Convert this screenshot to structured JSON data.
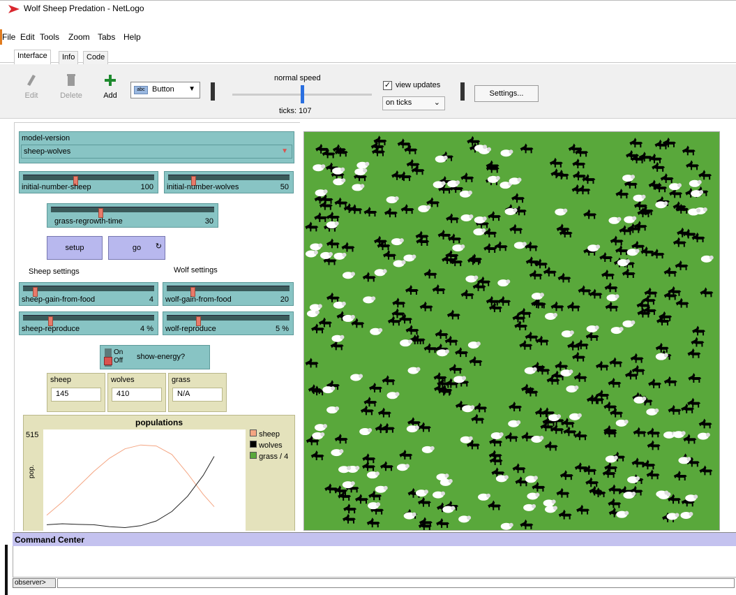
{
  "window": {
    "title": "Wolf Sheep Predation - NetLogo"
  },
  "menu": [
    "File",
    "Edit",
    "Tools",
    "Zoom",
    "Tabs",
    "Help"
  ],
  "tabs": [
    {
      "label": "Interface",
      "active": true
    },
    {
      "label": "Info",
      "active": false
    },
    {
      "label": "Code",
      "active": false
    }
  ],
  "toolbar": {
    "edit": "Edit",
    "delete": "Delete",
    "add": "Add",
    "widget_type": "Button",
    "speed_label": "normal speed",
    "speed_fraction": 0.5,
    "ticks": "ticks: 107",
    "view_updates_label": "view updates",
    "view_updates_checked": true,
    "update_mode": "on ticks",
    "settings": "Settings..."
  },
  "widgets": {
    "chooser": {
      "label": "model-version",
      "value": "sheep-wolves"
    },
    "sliders": {
      "initial_sheep": {
        "label": "initial-number-sheep",
        "value": "100",
        "fraction": 0.4
      },
      "initial_wolves": {
        "label": "initial-number-wolves",
        "value": "50",
        "fraction": 0.2
      },
      "grass_regrowth": {
        "label": "grass-regrowth-time",
        "value": "30",
        "fraction": 0.3
      },
      "sheep_gain": {
        "label": "sheep-gain-from-food",
        "value": "4",
        "fraction": 0.08
      },
      "wolf_gain": {
        "label": "wolf-gain-from-food",
        "value": "20",
        "fraction": 0.2
      },
      "sheep_reproduce": {
        "label": "sheep-reproduce",
        "value": "4 %",
        "fraction": 0.2
      },
      "wolf_reproduce": {
        "label": "wolf-reproduce",
        "value": "5 %",
        "fraction": 0.25
      }
    },
    "buttons": {
      "setup": "setup",
      "go": "go"
    },
    "notes": {
      "sheep_settings": "Sheep settings",
      "wolf_settings": "Wolf settings"
    },
    "switch": {
      "label": "show-energy?",
      "on": "On",
      "off": "Off",
      "state": "off"
    },
    "monitors": [
      {
        "label": "sheep",
        "value": "145"
      },
      {
        "label": "wolves",
        "value": "410"
      },
      {
        "label": "grass",
        "value": "N/A"
      }
    ]
  },
  "plot": {
    "title": "populations",
    "ylabel": "pop.",
    "ymax_label": "515",
    "legend": [
      {
        "name": "sheep",
        "color": "#f4a582"
      },
      {
        "name": "wolves",
        "color": "#000000"
      },
      {
        "name": "grass / 4",
        "color": "#59a83b"
      }
    ]
  },
  "chart_data": {
    "type": "line",
    "title": "populations",
    "ylabel": "pop.",
    "ylim": [
      0,
      515
    ],
    "x": [
      0,
      10,
      20,
      30,
      40,
      50,
      60,
      70,
      80,
      90,
      100,
      107
    ],
    "series": [
      {
        "name": "sheep",
        "values": [
          100,
          170,
          250,
          330,
          400,
          450,
          470,
          465,
          420,
          320,
          210,
          145
        ]
      },
      {
        "name": "wolves",
        "values": [
          50,
          55,
          52,
          50,
          40,
          35,
          45,
          70,
          120,
          200,
          310,
          410
        ]
      }
    ]
  },
  "command_center": {
    "title": "Command Center",
    "prompt": "observer>"
  },
  "colors": {
    "grass": "#59a83b",
    "widget": "#88c4c4",
    "button": "#b8b8ee",
    "monitor": "#e4e2bc",
    "command_header": "#c4c2ef"
  }
}
